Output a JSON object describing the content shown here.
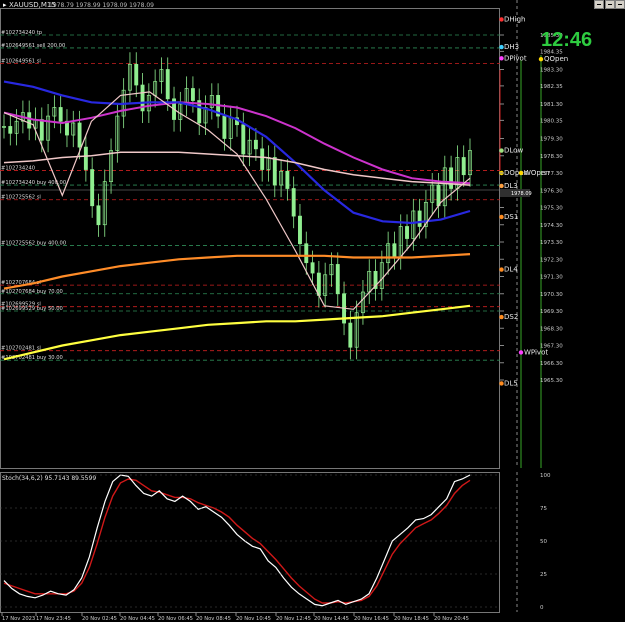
{
  "window": {
    "title": "XAUUSD,M15",
    "ohlc_readout": "1978.79 1978.99 1978.09 1978.09",
    "clock": "12:46",
    "osc_title": "Stoch(34,6,2) 95.7143 89.5599"
  },
  "price_axis": {
    "ticks": [
      "1985.30",
      "1984.35",
      "1983.30",
      "1982.35",
      "1981.30",
      "1980.35",
      "1979.30",
      "1978.30",
      "1977.30",
      "1976.30",
      "1975.30",
      "1974.30",
      "1973.30",
      "1972.30",
      "1971.30",
      "1970.30",
      "1969.30",
      "1968.30",
      "1967.30",
      "1966.30",
      "1965.30"
    ],
    "current_price": "1978.09"
  },
  "osc_axis": {
    "ticks": [
      "100",
      "75",
      "50",
      "25",
      "0"
    ]
  },
  "time_axis": {
    "labels": [
      "17 Nov 2023",
      "17 Nov 23:45",
      "20 Nov 02:45",
      "20 Nov 04:45",
      "20 Nov 06:45",
      "20 Nov 08:45",
      "20 Nov 10:45",
      "20 Nov 12:45",
      "20 Nov 14:45",
      "20 Nov 16:45",
      "20 Nov 18:45",
      "20 Nov 20:45"
    ]
  },
  "order_lines": [
    {
      "label": "#102734240 tp",
      "price": 1985.3,
      "color": "#2e8b57"
    },
    {
      "label": "#102649561 sell 200.00",
      "price": 1984.55,
      "color": "#2e8b57"
    },
    {
      "label": "#102649561 sl",
      "price": 1983.65,
      "color": "#cc2020"
    },
    {
      "label": "#102734240",
      "price": 1977.45,
      "color": "#cc2020"
    },
    {
      "label": "#102734240 buy 400.00",
      "price": 1976.6,
      "color": "#2e8b57"
    },
    {
      "label": "#102725562 sl",
      "price": 1975.75,
      "color": "#cc2020"
    },
    {
      "label": "#102725562 buy 400.00",
      "price": 1973.1,
      "color": "#2e8b57"
    },
    {
      "label": "#102707684 sl",
      "price": 1970.8,
      "color": "#cc2020"
    },
    {
      "label": "#102707684 buy 70.00",
      "price": 1970.3,
      "color": "#2e8b57"
    },
    {
      "label": "#102699529 sl",
      "price": 1969.55,
      "color": "#cc2020"
    },
    {
      "label": "#102699529 buy 50.00",
      "price": 1969.3,
      "color": "#2e8b57"
    },
    {
      "label": "#102702481 sl",
      "price": 1967.0,
      "color": "#cc2020"
    },
    {
      "label": "#102702481 buy 30.00",
      "price": 1966.45,
      "color": "#2e8b57"
    }
  ],
  "pivot_markers": [
    {
      "label": "DHigh",
      "price": 1986.2,
      "color": "#ff3030"
    },
    {
      "label": "DH3",
      "price": 1984.6,
      "color": "#40d0ff"
    },
    {
      "label": "DPivot",
      "price": 1983.95,
      "color": "#ff40ff"
    },
    {
      "label": "DLow",
      "price": 1978.6,
      "color": "#a0e080"
    },
    {
      "label": "DOpen",
      "price": 1977.3,
      "color": "#ffd700"
    },
    {
      "label": "DL3",
      "price": 1976.55,
      "color": "#ffa040"
    },
    {
      "label": "DS1",
      "price": 1974.75,
      "color": "#ff8c20"
    },
    {
      "label": "DL4",
      "price": 1971.7,
      "color": "#ff8c20"
    },
    {
      "label": "DS2",
      "price": 1968.95,
      "color": "#ff8c20"
    },
    {
      "label": "DL5",
      "price": 1965.1,
      "color": "#ff8c20"
    }
  ],
  "right_markers": [
    {
      "label": "QOpen",
      "price": 1983.9,
      "color": "#ffd700"
    },
    {
      "label": "WOpen",
      "price": 1977.3,
      "color": "#ffd700"
    },
    {
      "label": "WPivot",
      "price": 1966.9,
      "color": "#ff40ff"
    }
  ],
  "colors": {
    "candle": "#90ee90",
    "ma_magenta": "#cc33cc",
    "ma_blue": "#2828e0",
    "ma_pink": "#f0c8c8",
    "ma_orange": "#ff8c28",
    "ma_yellow": "#ffff40",
    "stoch_main": "#ffffff",
    "stoch_signal": "#d01818",
    "grid": "#505050"
  }
}
